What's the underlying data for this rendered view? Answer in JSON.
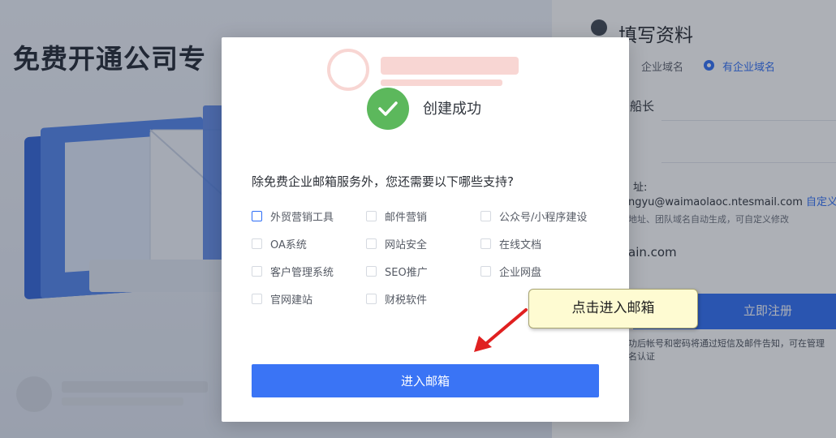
{
  "background": {
    "hero_title": "免费开通公司专",
    "form": {
      "title": "填写资料",
      "domain_option_without": "企业域名",
      "domain_option_with": "有企业域名",
      "company_name_fragment": "船长",
      "email_label_fragment": "址:",
      "email_fragment": "ngyu@waimaolaoc.ntesmail.com",
      "email_custom_link": "自定义",
      "email_hint": "地址、团队域名自动生成，可自定义修改",
      "domain_fragment": "ain.com",
      "register_button": "立即注册",
      "notice_line1": "功后帐号和密码将通过短信及邮件告知，可在管理",
      "notice_line2": "名认证"
    }
  },
  "modal": {
    "success_text": "创建成功",
    "question": "除免费企业邮箱服务外，您还需要以下哪些支持?",
    "options": [
      {
        "label": "外贸营销工具",
        "checked": false,
        "focused": true
      },
      {
        "label": "邮件营销",
        "checked": false
      },
      {
        "label": "公众号/小程序建设",
        "checked": false
      },
      {
        "label": "OA系统",
        "checked": false
      },
      {
        "label": "网站安全",
        "checked": false
      },
      {
        "label": "在线文档",
        "checked": false
      },
      {
        "label": "客户管理系统",
        "checked": false
      },
      {
        "label": "SEO推广",
        "checked": false
      },
      {
        "label": "企业网盘",
        "checked": false
      },
      {
        "label": "官网建站",
        "checked": false
      },
      {
        "label": "财税软件",
        "checked": false
      }
    ],
    "enter_button": "进入邮箱"
  },
  "annotation": {
    "callout_text": "点击进入邮箱"
  },
  "colors": {
    "primary": "#3a74f5",
    "success": "#5cb85c",
    "callout_bg": "#fefbd2",
    "arrow": "#e02020"
  }
}
